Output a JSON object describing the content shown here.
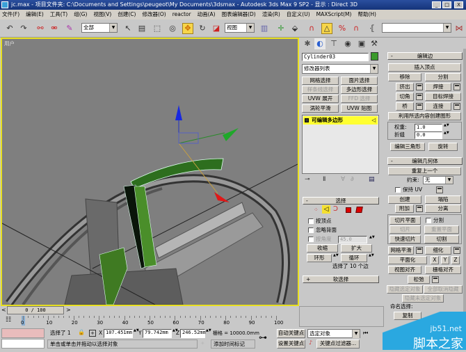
{
  "window": {
    "title": "jc.max   - 项目文件夹: C:\\Documents and Settings\\peugeot\\My Documents\\3dsmax   - Autodesk 3ds Max 9 SP2   - 显示 : Direct 3D",
    "controls": [
      "_",
      "□",
      "X"
    ]
  },
  "menu": [
    "文件(F)",
    "编辑(E)",
    "工具(T)",
    "组(G)",
    "视图(V)",
    "创建(C)",
    "修改器(O)",
    "reactor",
    "动画(A)",
    "图表编辑器(D)",
    "渲染(R)",
    "自定义(U)",
    "MAXScript(M)",
    "帮助(H)"
  ],
  "toolbar": {
    "selection_filter": "全部",
    "ref_coord": "视图",
    "named_selection": ""
  },
  "viewport": {
    "label": "用户",
    "accent": "#e8e020"
  },
  "command_panel": {
    "object_name": "Cylinder03",
    "object_color": "#3a9a2a",
    "modifier_list": "修改器列表",
    "modifier_buttons": [
      "网格选择",
      "面片选择",
      "样条线选择",
      "多边形选择",
      "UVW 展开",
      "FFD 选择",
      "涡轮平滑",
      "UVW 贴图"
    ],
    "stack_item": "可编辑多边形"
  },
  "selection_rollout": {
    "title": "选择",
    "by_vertex": "按顶点",
    "ignore_backfacing": "忽略背面",
    "by_angle": "按角度",
    "angle_value": "45.0",
    "shrink": "收缩",
    "grow": "扩大",
    "ring": "环形",
    "loop": "循环",
    "status": "选择了 10 个边",
    "soft_selection": "软选择"
  },
  "edit_edges": {
    "title": "编辑边",
    "insert_vertex": "插入顶点",
    "remove": "移除",
    "split": "分割",
    "extrude": "挤出",
    "weld": "焊接",
    "chamfer": "切角",
    "target_weld": "目标焊接",
    "bridge": "桥",
    "connect": "连接",
    "create_shape": "利用所选内容创建图形",
    "weight_label": "权重:",
    "weight_value": "1.0",
    "crease_label": "折缝",
    "crease_value": "0.0",
    "edit_tri": "编辑三角形",
    "turn": "旋转"
  },
  "edit_geometry": {
    "title": "编辑几何体",
    "repeat_last": "重复上一个",
    "constraint_label": "约束:",
    "constraint_value": "无",
    "preserve_uv": "保持 UV",
    "create": "创建",
    "collapse": "塌陷",
    "attach": "附加",
    "detach": "分离",
    "slice_plane": "切片平面",
    "split": "分割",
    "slice": "切片",
    "reset_plane": "重置平面",
    "quickslice": "快速切片",
    "cut": "切割",
    "meshsmooth": "网格平滑",
    "tessellate": "细化",
    "make_planar": "平面化",
    "x": "X",
    "y": "Y",
    "z": "Z",
    "view_align": "视图对齐",
    "grid_align": "栅格对齐",
    "relax": "松弛",
    "hide_selected": "隐藏选定对象",
    "unhide_all": "全部取消隐藏",
    "hide_unselected": "隐藏未选定对象",
    "named_selections": "命名选择:",
    "copy": "复制"
  },
  "timeline": {
    "frame": "0 / 100",
    "ticks": [
      "0",
      "10",
      "20",
      "30",
      "40",
      "50",
      "60",
      "70",
      "80",
      "90",
      "100"
    ]
  },
  "status": {
    "selected": "选择了 1",
    "x_label": "X",
    "x": "107.451mm",
    "y_label": "Y",
    "y": "79.742mm",
    "z_label": "Z",
    "z": "246.52mm",
    "grid": "栅格 = 10000.0mm",
    "prompt": "单击或单击并拖动以选择对象",
    "add_time_tag": "添加时间标记",
    "auto_key": "自动关键点",
    "set_key": "设置关键点",
    "key_mode": "选定对象",
    "key_filters": "关键点过滤器..."
  },
  "watermark": {
    "line1": "jb51.net",
    "line2": "脚本之家"
  }
}
